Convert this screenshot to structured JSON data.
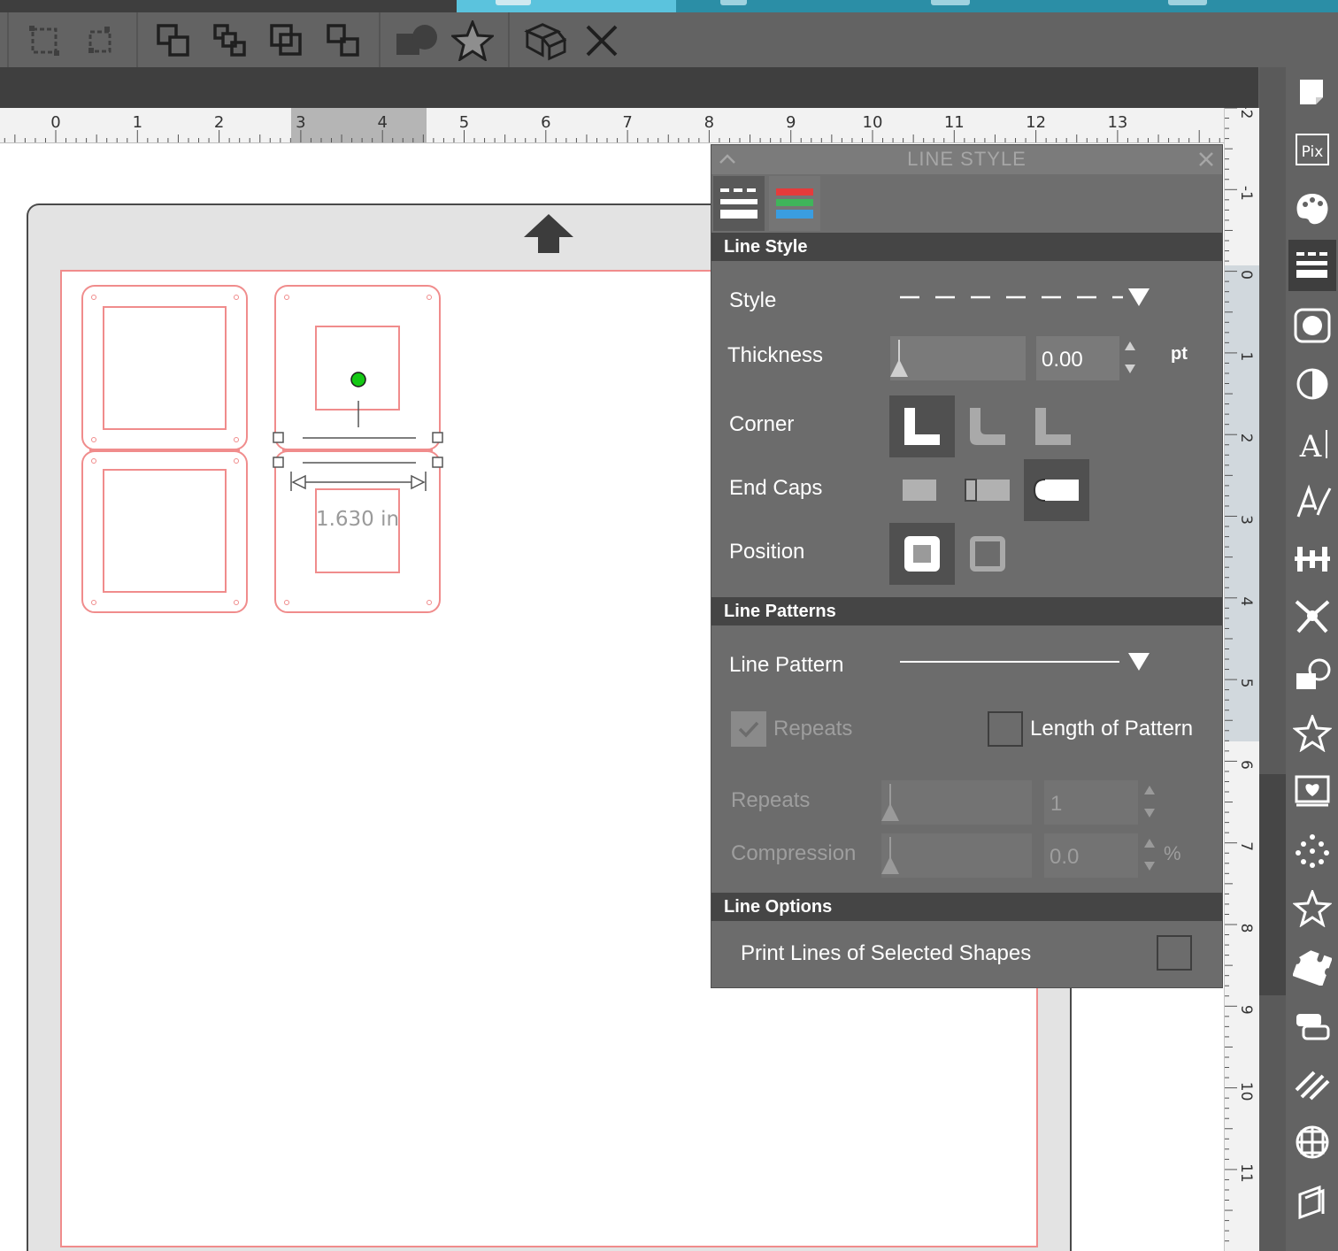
{
  "toolbar": {
    "buttons": [
      {
        "name": "group-icon"
      },
      {
        "name": "ungroup-icon"
      },
      {
        "name": "bring-to-front-icon"
      },
      {
        "name": "bring-forward-icon"
      },
      {
        "name": "send-backward-icon"
      },
      {
        "name": "send-to-back-icon"
      },
      {
        "name": "shapes-icon"
      },
      {
        "name": "star-icon"
      },
      {
        "name": "3d-box-icon"
      },
      {
        "name": "close-icon"
      }
    ]
  },
  "ruler": {
    "h_labels": [
      "0",
      "1",
      "2",
      "3",
      "4",
      "5",
      "6",
      "7",
      "8",
      "9",
      "10",
      "11",
      "12",
      "13"
    ],
    "v_labels": [
      "-2",
      "-1",
      "0",
      "1",
      "2",
      "3",
      "4",
      "5",
      "6",
      "7",
      "8",
      "9",
      "10",
      "11",
      "1"
    ]
  },
  "canvas": {
    "dimension_label": "1.630 in"
  },
  "panel": {
    "title": "LINE STYLE",
    "sections": {
      "line_style": "Line Style",
      "line_patterns": "Line Patterns",
      "line_options": "Line Options"
    },
    "style_label": "Style",
    "thickness_label": "Thickness",
    "thickness_value": "0.00",
    "thickness_unit": "pt",
    "corner_label": "Corner",
    "end_caps_label": "End Caps",
    "position_label": "Position",
    "line_pattern_label": "Line Pattern",
    "repeats_checkbox_label": "Repeats",
    "length_of_pattern_label": "Length of Pattern",
    "repeats_label": "Repeats",
    "repeats_value": "1",
    "compression_label": "Compression",
    "compression_value": "0.0",
    "compression_unit": "%",
    "print_lines_label": "Print Lines of Selected Shapes",
    "corner_selected": "sharp",
    "end_caps_selected": "round",
    "position_selected": "inside"
  },
  "colors": {
    "cut_line": "#f08c8c",
    "panel_bg": "#6c6c6c",
    "accent_tab": "#5bc3dd",
    "handle_green": "#14c814"
  },
  "side_panel": {
    "icons": [
      "page-setup-icon",
      "pixscan-icon",
      "fill-color-icon",
      "line-style-icon",
      "fill-pattern-icon",
      "transparency-icon",
      "text-style-icon",
      "sketch-icon",
      "align-icon",
      "replicate-icon",
      "modify-icon",
      "star-offset-icon",
      "image-effects-icon",
      "trace-icon",
      "favorite-star-icon",
      "puzzle-icon",
      "nest-icon",
      "texture-icon",
      "cut-settings-icon",
      "library-icon"
    ]
  }
}
